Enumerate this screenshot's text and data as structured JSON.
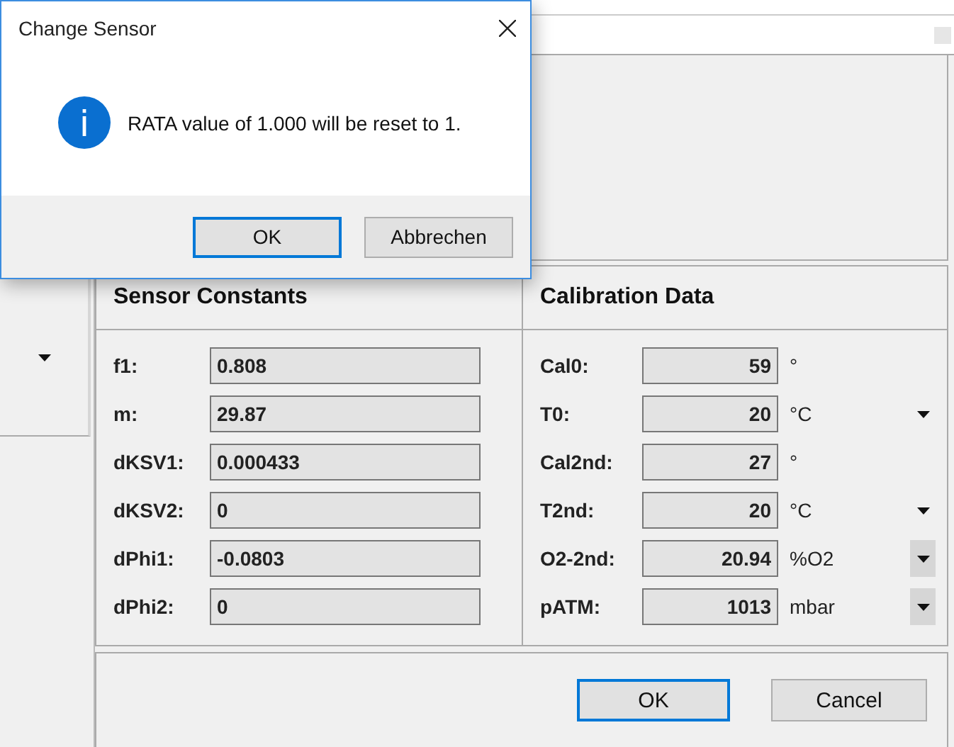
{
  "dialog": {
    "title": "Change Sensor",
    "message": "RATA value of 1.000 will be reset to 1.",
    "buttons": [
      {
        "label": "OK",
        "selected": true
      },
      {
        "label": "Abbrechen",
        "selected": false
      }
    ]
  },
  "sensor_constants": {
    "title": "Sensor Constants",
    "rows": [
      {
        "label": "f1:",
        "value": "0.808"
      },
      {
        "label": "m:",
        "value": "29.87"
      },
      {
        "label": "dKSV1:",
        "value": "0.000433"
      },
      {
        "label": "dKSV2:",
        "value": "0"
      },
      {
        "label": "dPhi1:",
        "value": "-0.0803"
      },
      {
        "label": "dPhi2:",
        "value": "0"
      }
    ]
  },
  "calibration_data": {
    "title": "Calibration Data",
    "rows": [
      {
        "label": "Cal0:",
        "value": "59",
        "unit": "°",
        "dropdown": false
      },
      {
        "label": "T0:",
        "value": "20",
        "unit": "°C",
        "dropdown": true,
        "shaded": false
      },
      {
        "label": "Cal2nd:",
        "value": "27",
        "unit": "°",
        "dropdown": false
      },
      {
        "label": "T2nd:",
        "value": "20",
        "unit": "°C",
        "dropdown": true,
        "shaded": false
      },
      {
        "label": "O2-2nd:",
        "value": "20.94",
        "unit": "%O2",
        "dropdown": true,
        "shaded": true
      },
      {
        "label": "pATM:",
        "value": "1013",
        "unit": "mbar",
        "dropdown": true,
        "shaded": true
      }
    ]
  },
  "buttons": [
    {
      "label": "OK",
      "selected": true
    },
    {
      "label": "Cancel",
      "selected": false
    }
  ]
}
